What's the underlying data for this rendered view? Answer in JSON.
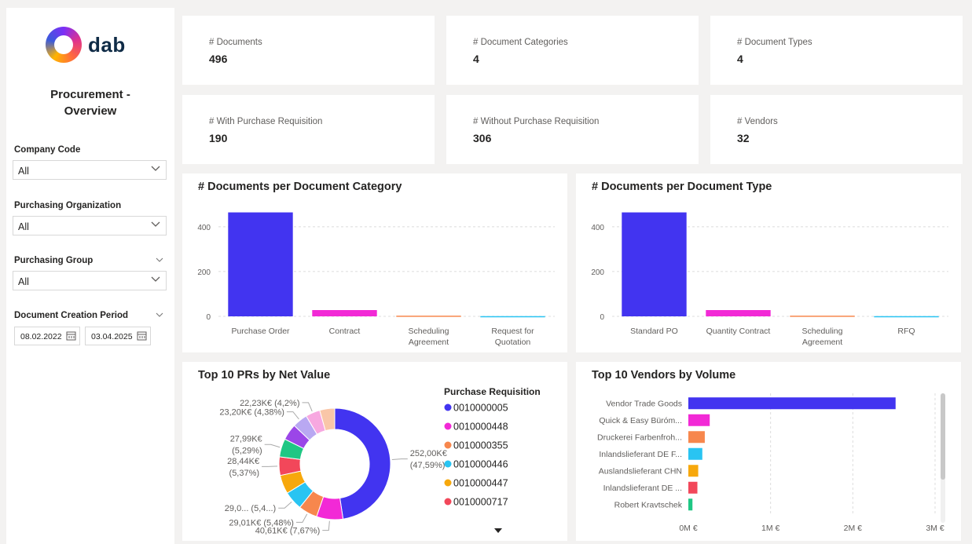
{
  "brand": {
    "logo_text": "dab"
  },
  "sidebar": {
    "title_line1": "Procurement -",
    "title_line2": "Overview",
    "slicers": [
      {
        "label": "Company Code",
        "value": "All"
      },
      {
        "label": "Purchasing Organization",
        "value": "All"
      },
      {
        "label": "Purchasing Group",
        "value": "All"
      }
    ],
    "date_slicer": {
      "label": "Document Creation Period",
      "from": "08.02.2022",
      "to": "03.04.2025"
    }
  },
  "kpis": [
    {
      "label": "# Documents",
      "value": "496"
    },
    {
      "label": "# Document Categories",
      "value": "4"
    },
    {
      "label": "# Document Types",
      "value": "4"
    },
    {
      "label": "# With Purchase Requisition",
      "value": "190"
    },
    {
      "label": "# Without Purchase Requisition",
      "value": "306"
    },
    {
      "label": "# Vendors",
      "value": "32"
    }
  ],
  "colors": {
    "blue": "#4234f0",
    "magenta": "#f229d6",
    "orange": "#f7874d",
    "cyan": "#29c4f2",
    "amber": "#f7a80c",
    "red": "#f2475a",
    "green": "#1fc784",
    "purple": "#9b46e8",
    "lavender": "#b9a8f2",
    "pink": "#f7a8e0",
    "peach": "#f9c6a8"
  },
  "chart_data": [
    {
      "type": "bar",
      "title": "# Documents per Document Category",
      "categories": [
        [
          "Purchase Order"
        ],
        [
          "Contract"
        ],
        [
          "Scheduling",
          "Agreement"
        ],
        [
          "Request for",
          "Quotation"
        ]
      ],
      "values": [
        464,
        28,
        3,
        1
      ],
      "yticks": [
        "0",
        "200",
        "400"
      ],
      "ylim": [
        0,
        480
      ],
      "colors": [
        "#4234f0",
        "#f229d6",
        "#f7874d",
        "#29c4f2"
      ]
    },
    {
      "type": "bar",
      "title": "# Documents per Document Type",
      "categories": [
        [
          "Standard PO"
        ],
        [
          "Quantity Contract"
        ],
        [
          "Scheduling",
          "Agreement"
        ],
        [
          "RFQ"
        ]
      ],
      "values": [
        464,
        28,
        3,
        1
      ],
      "yticks": [
        "0",
        "200",
        "400"
      ],
      "ylim": [
        0,
        480
      ],
      "colors": [
        "#4234f0",
        "#f229d6",
        "#f7874d",
        "#29c4f2"
      ]
    },
    {
      "type": "pie",
      "title": "Top 10 PRs by Net Value",
      "legend_title": "Purchase Requisition",
      "legend": [
        {
          "name": "0010000005",
          "color": "#4234f0"
        },
        {
          "name": "0010000448",
          "color": "#f229d6"
        },
        {
          "name": "0010000355",
          "color": "#f7874d"
        },
        {
          "name": "0010000446",
          "color": "#29c4f2"
        },
        {
          "name": "0010000447",
          "color": "#f7a80c"
        },
        {
          "name": "0010000717",
          "color": "#f2475a"
        }
      ],
      "slices": [
        {
          "value": 252.0,
          "pct": 47.59,
          "lines": [
            "252,00K€",
            "(47,59%)"
          ],
          "color": "#4234f0"
        },
        {
          "value": 40.61,
          "pct": 7.67,
          "lines": [
            "40,61K€ (7,67%)"
          ],
          "color": "#f229d6"
        },
        {
          "value": 29.01,
          "pct": 5.48,
          "lines": [
            "29,01K€ (5,48%)"
          ],
          "color": "#f7874d"
        },
        {
          "value": 29.0,
          "pct": 5.4,
          "lines": [
            "29,0... (5,4...)"
          ],
          "color": "#29c4f2"
        },
        {
          "value": 28.8,
          "pct": 5.44,
          "lines": [],
          "color": "#f7a80c"
        },
        {
          "value": 28.44,
          "pct": 5.37,
          "lines": [
            "28,44K€",
            "(5,37%)"
          ],
          "color": "#f2475a"
        },
        {
          "value": 27.99,
          "pct": 5.29,
          "lines": [
            "27,99K€",
            "(5,29%)"
          ],
          "color": "#1fc784"
        },
        {
          "value": 25.0,
          "pct": 4.72,
          "lines": [],
          "color": "#9b46e8"
        },
        {
          "value": 23.2,
          "pct": 4.38,
          "lines": [
            "23,20K€ (4,38%)"
          ],
          "color": "#b9a8f2"
        },
        {
          "value": 22.23,
          "pct": 4.2,
          "lines": [
            "22,23K€ (4,2%)"
          ],
          "color": "#f7a8e0"
        },
        {
          "value": 23.0,
          "pct": 4.34,
          "lines": [],
          "color": "#f9c6a8"
        }
      ]
    },
    {
      "type": "bar",
      "orientation": "horizontal",
      "title": "Top 10 Vendors by Volume",
      "categories": [
        "Vendor Trade Goods",
        "Quick & Easy Büróm...",
        "Druckerei Farbenfroh...",
        "Inlandslieferant DE F...",
        "Auslandslieferant CHN",
        "Inlandslieferant DE ...",
        "Robert Kravtschek"
      ],
      "values": [
        2.52,
        0.26,
        0.2,
        0.17,
        0.12,
        0.11,
        0.05
      ],
      "xticks": [
        "0M €",
        "1M €",
        "2M €",
        "3M €"
      ],
      "xlim": [
        0,
        3
      ],
      "colors": [
        "#4234f0",
        "#f229d6",
        "#f7874d",
        "#29c4f2",
        "#f7a80c",
        "#f2475a",
        "#1fc784"
      ]
    }
  ]
}
